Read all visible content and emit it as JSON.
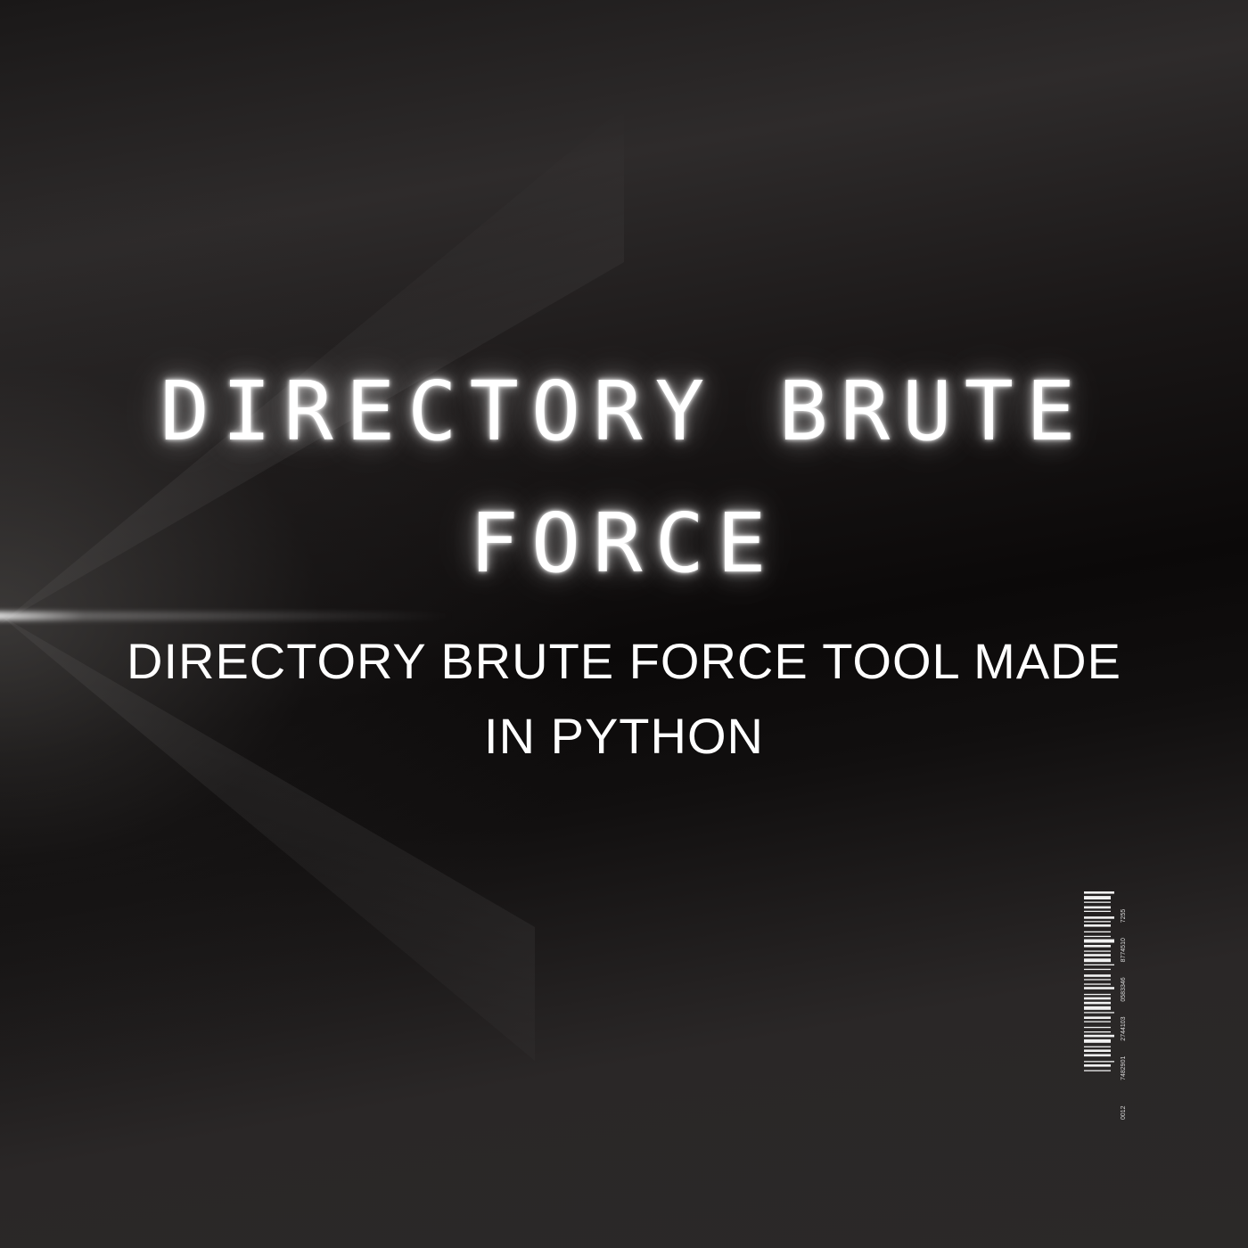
{
  "title": {
    "line1": "DIRECTORY BRUTE",
    "line2": "FORCE"
  },
  "subtitle": {
    "line1": "DIRECTORY BRUTE FORCE TOOL MADE",
    "line2": "IN PYTHON"
  },
  "barcode": {
    "digits": [
      "0012",
      "7482901",
      "2744103",
      "0583346",
      "8774510",
      "7255"
    ]
  },
  "colors": {
    "text": "#ffffff",
    "background": "#0e0c0c"
  }
}
